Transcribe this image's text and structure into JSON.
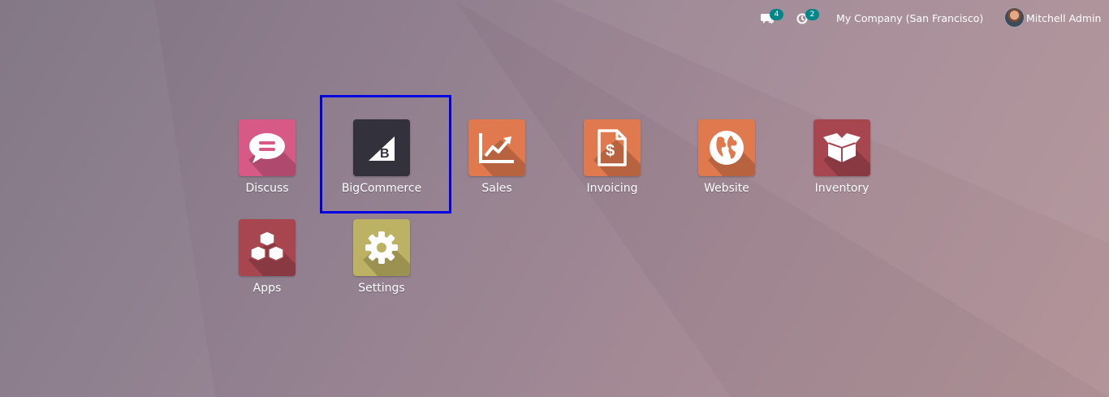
{
  "topbar": {
    "chat_badge": "4",
    "activity_badge": "2",
    "company": "My Company (San Francisco)",
    "user_name": "Mitchell Admin"
  },
  "apps": [
    {
      "label": "Discuss",
      "icon": "chat-bubble-icon",
      "color": "#d65a85"
    },
    {
      "label": "BigCommerce",
      "icon": "bigcommerce-logo-icon",
      "color": "#33313b"
    },
    {
      "label": "Sales",
      "icon": "trending-chart-icon",
      "color": "#e0794d"
    },
    {
      "label": "Invoicing",
      "icon": "invoice-dollar-icon",
      "color": "#e0794d"
    },
    {
      "label": "Website",
      "icon": "globe-icon",
      "color": "#e0794d"
    },
    {
      "label": "Inventory",
      "icon": "box-icon",
      "color": "#a84650"
    },
    {
      "label": "Apps",
      "icon": "cubes-icon",
      "color": "#a84650"
    },
    {
      "label": "Settings",
      "icon": "gear-icon",
      "color": "#bdb163"
    }
  ],
  "selection_color": "#0000e0"
}
